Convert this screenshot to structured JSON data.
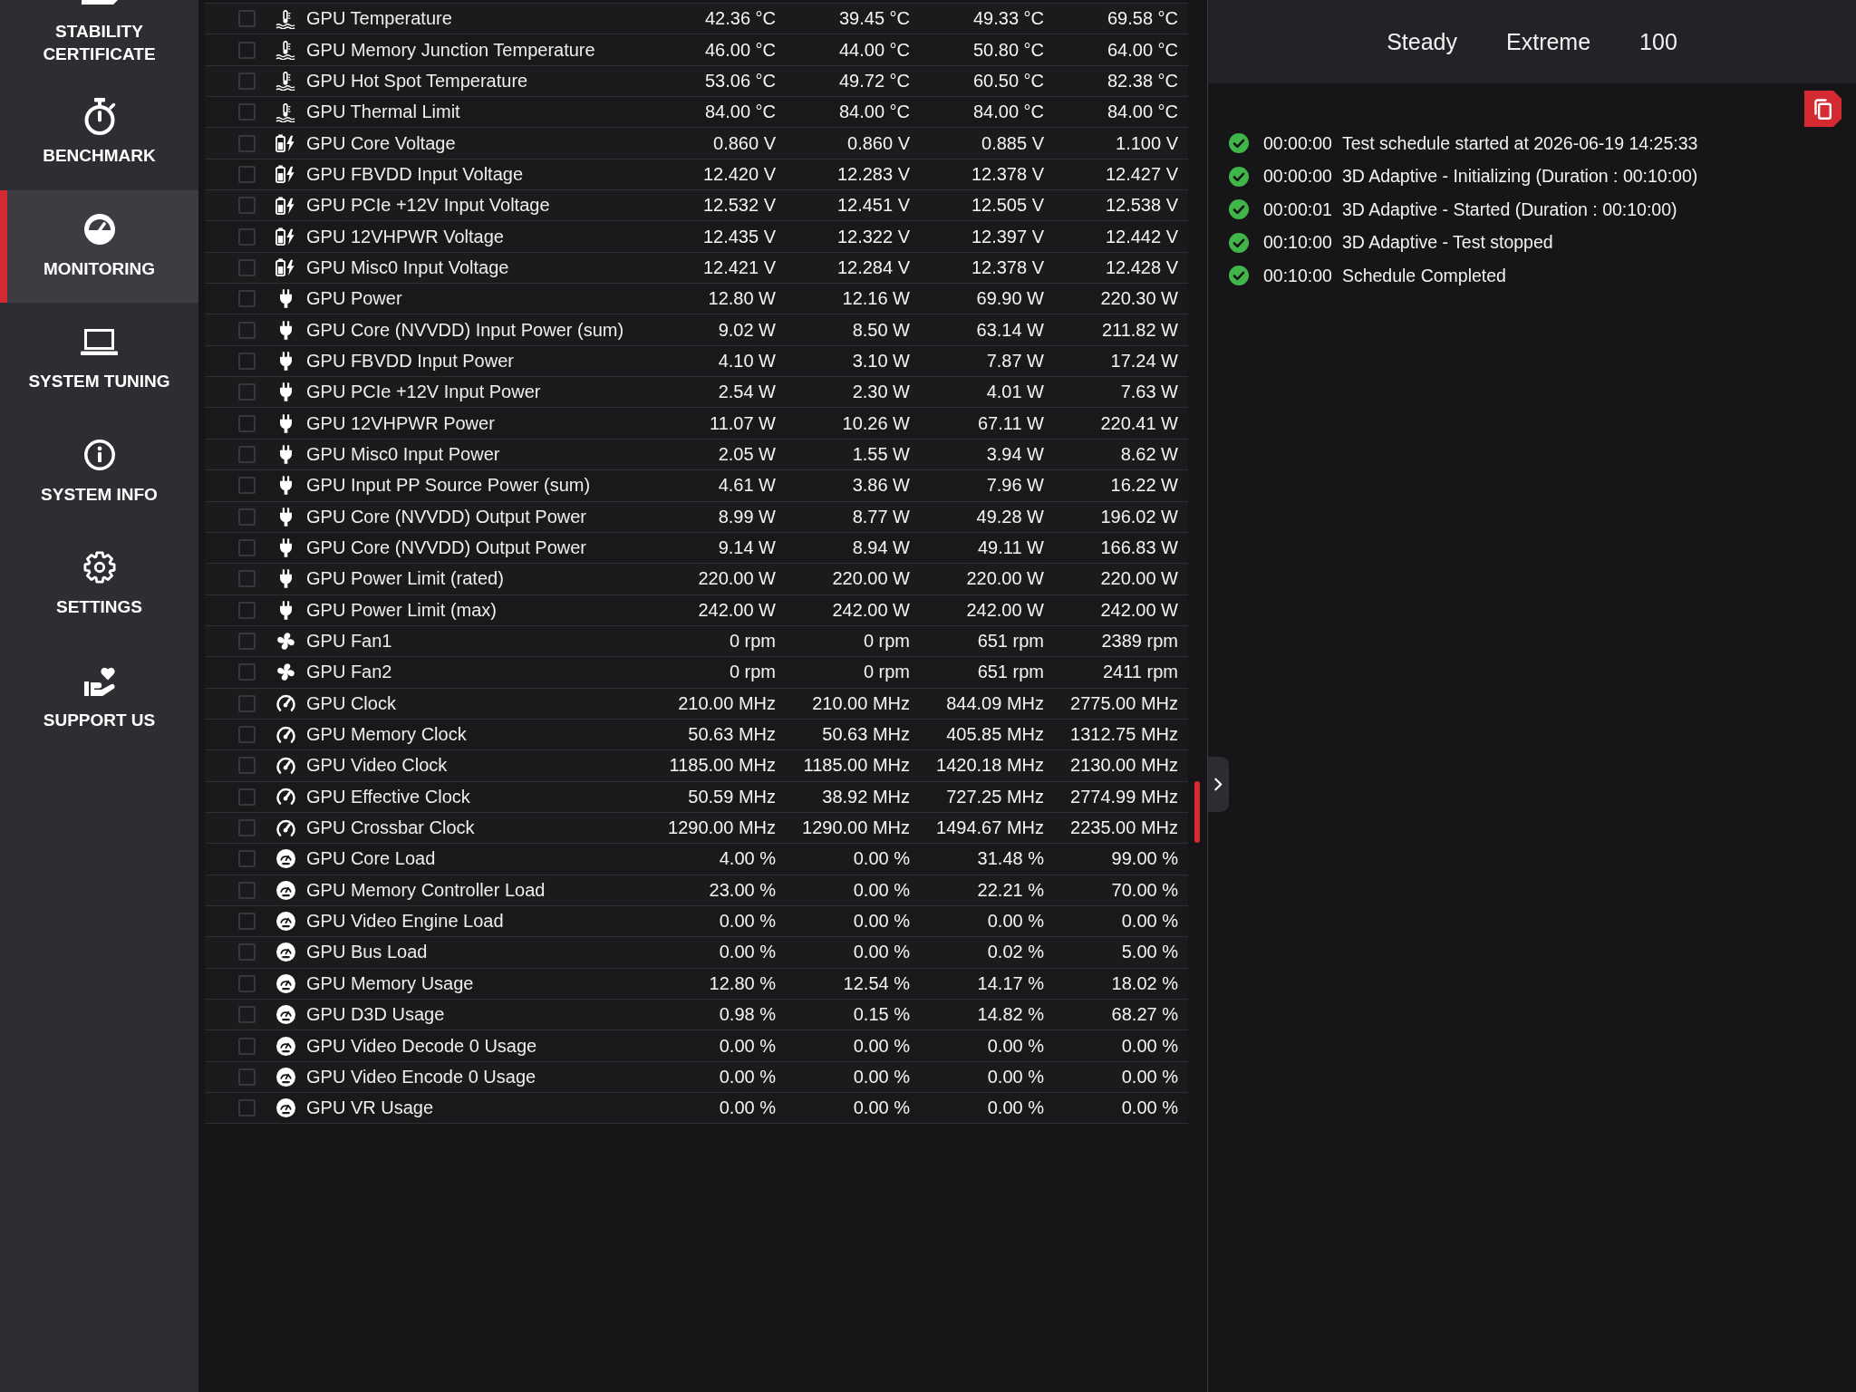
{
  "sidebar": {
    "items": [
      {
        "label": "STABILITY CERTIFICATE",
        "selected": false
      },
      {
        "label": "BENCHMARK",
        "selected": false
      },
      {
        "label": "MONITORING",
        "selected": true
      },
      {
        "label": "SYSTEM TUNING",
        "selected": false
      },
      {
        "label": "SYSTEM INFO",
        "selected": false
      },
      {
        "label": "SETTINGS",
        "selected": false
      },
      {
        "label": "SUPPORT US",
        "selected": false
      }
    ]
  },
  "sensor_table": {
    "rows": [
      {
        "kind": "temperature",
        "checked": false,
        "name": "GPU Temperature",
        "values": [
          "42.36 °C",
          "39.45 °C",
          "49.33 °C",
          "69.58 °C"
        ]
      },
      {
        "kind": "temperature",
        "checked": false,
        "name": "GPU Memory Junction Temperature",
        "values": [
          "46.00 °C",
          "44.00 °C",
          "50.80 °C",
          "64.00 °C"
        ]
      },
      {
        "kind": "temperature",
        "checked": false,
        "name": "GPU Hot Spot Temperature",
        "values": [
          "53.06 °C",
          "49.72 °C",
          "60.50 °C",
          "82.38 °C"
        ]
      },
      {
        "kind": "temperature",
        "checked": false,
        "name": "GPU Thermal Limit",
        "values": [
          "84.00 °C",
          "84.00 °C",
          "84.00 °C",
          "84.00 °C"
        ]
      },
      {
        "kind": "voltage",
        "checked": false,
        "name": "GPU Core Voltage",
        "values": [
          "0.860 V",
          "0.860 V",
          "0.885 V",
          "1.100 V"
        ]
      },
      {
        "kind": "voltage",
        "checked": false,
        "name": "GPU FBVDD Input Voltage",
        "values": [
          "12.420 V",
          "12.283 V",
          "12.378 V",
          "12.427 V"
        ]
      },
      {
        "kind": "voltage",
        "checked": false,
        "name": "GPU PCIe +12V Input Voltage",
        "values": [
          "12.532 V",
          "12.451 V",
          "12.505 V",
          "12.538 V"
        ]
      },
      {
        "kind": "voltage",
        "checked": false,
        "name": "GPU 12VHPWR Voltage",
        "values": [
          "12.435 V",
          "12.322 V",
          "12.397 V",
          "12.442 V"
        ]
      },
      {
        "kind": "voltage",
        "checked": false,
        "name": "GPU Misc0 Input Voltage",
        "values": [
          "12.421 V",
          "12.284 V",
          "12.378 V",
          "12.428 V"
        ]
      },
      {
        "kind": "power",
        "checked": false,
        "name": "GPU Power",
        "values": [
          "12.80 W",
          "12.16 W",
          "69.90 W",
          "220.30 W"
        ]
      },
      {
        "kind": "power",
        "checked": false,
        "name": "GPU Core (NVVDD) Input Power (sum)",
        "values": [
          "9.02 W",
          "8.50 W",
          "63.14 W",
          "211.82 W"
        ]
      },
      {
        "kind": "power",
        "checked": false,
        "name": "GPU FBVDD Input Power",
        "values": [
          "4.10 W",
          "3.10 W",
          "7.87 W",
          "17.24 W"
        ]
      },
      {
        "kind": "power",
        "checked": false,
        "name": "GPU PCIe +12V Input Power",
        "values": [
          "2.54 W",
          "2.30 W",
          "4.01 W",
          "7.63 W"
        ]
      },
      {
        "kind": "power",
        "checked": false,
        "name": "GPU 12VHPWR Power",
        "values": [
          "11.07 W",
          "10.26 W",
          "67.11 W",
          "220.41 W"
        ]
      },
      {
        "kind": "power",
        "checked": false,
        "name": "GPU Misc0 Input Power",
        "values": [
          "2.05 W",
          "1.55 W",
          "3.94 W",
          "8.62 W"
        ]
      },
      {
        "kind": "power",
        "checked": false,
        "name": "GPU Input PP Source Power (sum)",
        "values": [
          "4.61 W",
          "3.86 W",
          "7.96 W",
          "16.22 W"
        ]
      },
      {
        "kind": "power",
        "checked": false,
        "name": "GPU Core (NVVDD) Output Power",
        "values": [
          "8.99 W",
          "8.77 W",
          "49.28 W",
          "196.02 W"
        ]
      },
      {
        "kind": "power",
        "checked": false,
        "name": "GPU Core (NVVDD) Output Power",
        "values": [
          "9.14 W",
          "8.94 W",
          "49.11 W",
          "166.83 W"
        ]
      },
      {
        "kind": "power",
        "checked": false,
        "name": "GPU Power Limit (rated)",
        "values": [
          "220.00 W",
          "220.00 W",
          "220.00 W",
          "220.00 W"
        ]
      },
      {
        "kind": "power",
        "checked": false,
        "name": "GPU Power Limit (max)",
        "values": [
          "242.00 W",
          "242.00 W",
          "242.00 W",
          "242.00 W"
        ]
      },
      {
        "kind": "fan",
        "checked": false,
        "name": "GPU Fan1",
        "values": [
          "0 rpm",
          "0 rpm",
          "651 rpm",
          "2389 rpm"
        ]
      },
      {
        "kind": "fan",
        "checked": false,
        "name": "GPU Fan2",
        "values": [
          "0 rpm",
          "0 rpm",
          "651 rpm",
          "2411 rpm"
        ]
      },
      {
        "kind": "clock",
        "checked": false,
        "name": "GPU Clock",
        "values": [
          "210.00 MHz",
          "210.00 MHz",
          "844.09 MHz",
          "2775.00 MHz"
        ]
      },
      {
        "kind": "clock",
        "checked": false,
        "name": "GPU Memory Clock",
        "values": [
          "50.63 MHz",
          "50.63 MHz",
          "405.85 MHz",
          "1312.75 MHz"
        ]
      },
      {
        "kind": "clock",
        "checked": false,
        "name": "GPU Video Clock",
        "values": [
          "1185.00 MHz",
          "1185.00 MHz",
          "1420.18 MHz",
          "2130.00 MHz"
        ]
      },
      {
        "kind": "clock",
        "checked": false,
        "name": "GPU Effective Clock",
        "values": [
          "50.59 MHz",
          "38.92 MHz",
          "727.25 MHz",
          "2774.99 MHz"
        ]
      },
      {
        "kind": "clock",
        "checked": false,
        "name": "GPU Crossbar Clock",
        "values": [
          "1290.00 MHz",
          "1290.00 MHz",
          "1494.67 MHz",
          "2235.00 MHz"
        ]
      },
      {
        "kind": "load",
        "checked": false,
        "name": "GPU Core Load",
        "values": [
          "4.00 %",
          "0.00 %",
          "31.48 %",
          "99.00 %"
        ]
      },
      {
        "kind": "load",
        "checked": false,
        "name": "GPU Memory Controller Load",
        "values": [
          "23.00 %",
          "0.00 %",
          "22.21 %",
          "70.00 %"
        ]
      },
      {
        "kind": "load",
        "checked": false,
        "name": "GPU Video Engine Load",
        "values": [
          "0.00 %",
          "0.00 %",
          "0.00 %",
          "0.00 %"
        ]
      },
      {
        "kind": "load",
        "checked": false,
        "name": "GPU Bus Load",
        "values": [
          "0.00 %",
          "0.00 %",
          "0.02 %",
          "5.00 %"
        ]
      },
      {
        "kind": "load",
        "checked": false,
        "name": "GPU Memory Usage",
        "values": [
          "12.80 %",
          "12.54 %",
          "14.17 %",
          "18.02 %"
        ]
      },
      {
        "kind": "load",
        "checked": false,
        "name": "GPU D3D Usage",
        "values": [
          "0.98 %",
          "0.15 %",
          "14.82 %",
          "68.27 %"
        ]
      },
      {
        "kind": "load",
        "checked": false,
        "name": "GPU Video Decode 0 Usage",
        "values": [
          "0.00 %",
          "0.00 %",
          "0.00 %",
          "0.00 %"
        ]
      },
      {
        "kind": "load",
        "checked": false,
        "name": "GPU Video Encode 0 Usage",
        "values": [
          "0.00 %",
          "0.00 %",
          "0.00 %",
          "0.00 %"
        ]
      },
      {
        "kind": "load",
        "checked": false,
        "name": "GPU VR Usage",
        "values": [
          "0.00 %",
          "0.00 %",
          "0.00 %",
          "0.00 %"
        ]
      }
    ]
  },
  "test_summary": [
    "Steady",
    "Extreme",
    "100"
  ],
  "event_log": {
    "entries": [
      {
        "completed": true,
        "time": "00:00:00",
        "message": "Test schedule started at 2026-06-19 14:25:33"
      },
      {
        "completed": true,
        "time": "00:00:00",
        "message": "3D Adaptive - Initializing (Duration : 00:10:00)"
      },
      {
        "completed": true,
        "time": "00:00:01",
        "message": "3D Adaptive - Started (Duration : 00:10:00)"
      },
      {
        "completed": true,
        "time": "00:10:00",
        "message": "3D Adaptive - Test stopped"
      },
      {
        "completed": true,
        "time": "00:10:00",
        "message": "Schedule Completed"
      }
    ]
  }
}
